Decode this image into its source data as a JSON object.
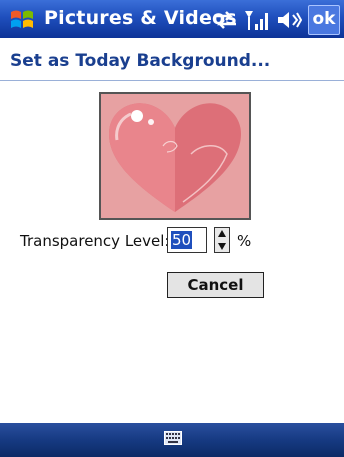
{
  "titlebar": {
    "title": "Pictures & Videos",
    "ok_label": "ok"
  },
  "header": {
    "title": "Set as Today Background..."
  },
  "transparency": {
    "label": "Transparency Level:",
    "value": "50",
    "unit": "%"
  },
  "buttons": {
    "cancel_label": "Cancel"
  },
  "icons": {
    "start": "windows-flag-icon",
    "connectivity": "sync-arrows-icon",
    "signal": "signal-strength-icon",
    "volume": "speaker-icon",
    "keyboard": "keyboard-icon"
  },
  "colors": {
    "titlebar": "#1f4fbd",
    "header_text": "#1a3f8f",
    "preview_bg": "#e9a7a7"
  }
}
